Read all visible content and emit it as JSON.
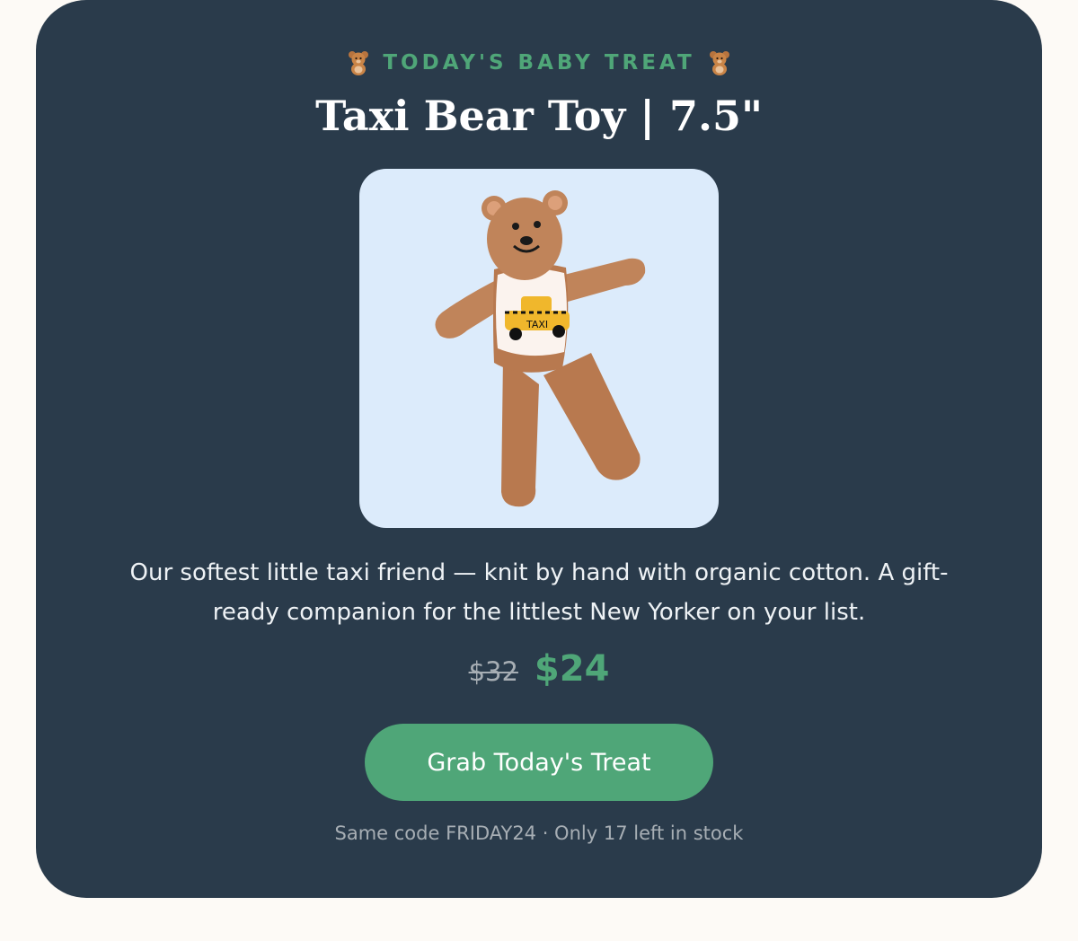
{
  "eyebrow": {
    "text": "TODAY'S BABY TREAT",
    "icon": "teddy-bear-icon"
  },
  "product": {
    "title": "Taxi Bear Toy | 7.5\"",
    "image_alt": "Taxi Bear Toy",
    "image_label_text": "TAXI",
    "description": "Our softest little taxi friend — knit by hand with organic cotton. A gift-ready companion for the littlest New Yorker on your list.",
    "original_price": "$32",
    "sale_price": "$24"
  },
  "cta": {
    "label": "Grab Today's Treat"
  },
  "footnote": "Same code FRIDAY24 · Only 17 left in stock",
  "colors": {
    "page_bg": "#fdfaf6",
    "card_bg": "#2a3b4b",
    "accent_green": "#4fa678",
    "image_bg": "#dcebfb",
    "muted_text": "#a7aeb4"
  }
}
